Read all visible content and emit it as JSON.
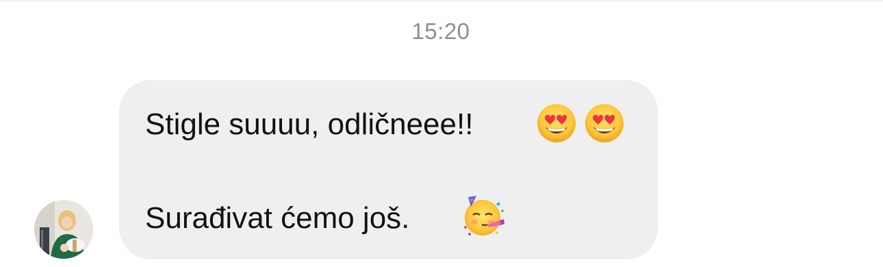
{
  "conversation": {
    "timestamp": "15:20",
    "message": {
      "line1": "Stigle suuuu, odličneee!!",
      "line2": "Surađivat ćemo još.",
      "emojis": [
        {
          "icon": "heart-eyes-emoji",
          "glyph": "😍"
        },
        {
          "icon": "heart-eyes-emoji",
          "glyph": "😍"
        },
        {
          "icon": "partying-face-emoji",
          "glyph": "🥳"
        }
      ]
    },
    "sender": {
      "avatar": "avatar"
    }
  },
  "colors": {
    "bubble": "#efefef",
    "timestamp": "#8e8e8e",
    "text": "#111111"
  }
}
